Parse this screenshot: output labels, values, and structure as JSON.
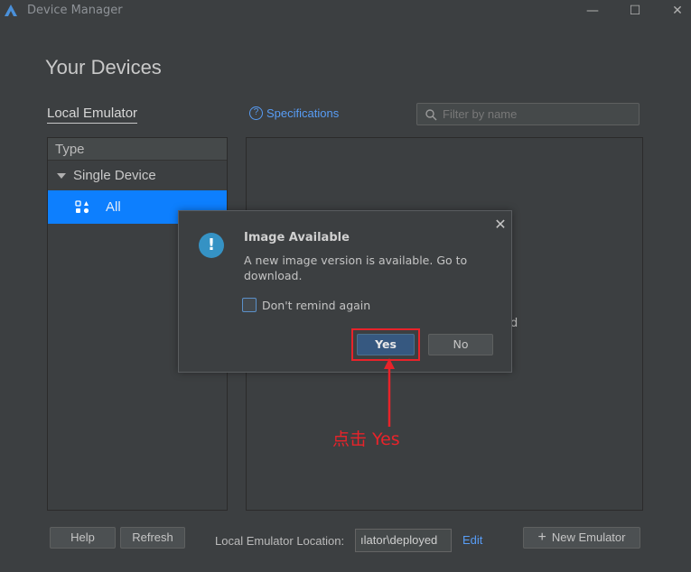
{
  "window": {
    "title": "Device Manager",
    "minimize_glyph": "—",
    "maximize_glyph": "☐",
    "close_glyph": "✕"
  },
  "page_title": "Your Devices",
  "tabs": {
    "local": "Local Emulator"
  },
  "specifications_link": {
    "icon": "?",
    "label": "Specifications"
  },
  "filter": {
    "placeholder": "Filter by name",
    "value": ""
  },
  "left_panel": {
    "header": "Type",
    "group": "Single Device",
    "selected_item": "All"
  },
  "background_partial_text": "d",
  "dialog": {
    "icon": "!",
    "title": "Image Available",
    "message": "A new image version is available. Go to download.",
    "checkbox_label": "Don't remind again",
    "checkbox_checked": false,
    "yes_label": "Yes",
    "no_label": "No",
    "close_glyph": "✕"
  },
  "annotation": {
    "text": "点击 Yes",
    "color": "#e8232a"
  },
  "bottom_bar": {
    "help_label": "Help",
    "refresh_label": "Refresh",
    "location_label": "Local Emulator Location:",
    "location_value": "...\\emulator\\deployed",
    "location_display": "ılator\\deployed",
    "edit_label": "Edit",
    "new_emulator_label": "New Emulator",
    "new_emulator_icon": "+"
  },
  "colors": {
    "background": "#3c3f41",
    "selection": "#0d7ffe",
    "link": "#589df6",
    "primary_button": "#365880",
    "annotation_red": "#e8232a"
  }
}
